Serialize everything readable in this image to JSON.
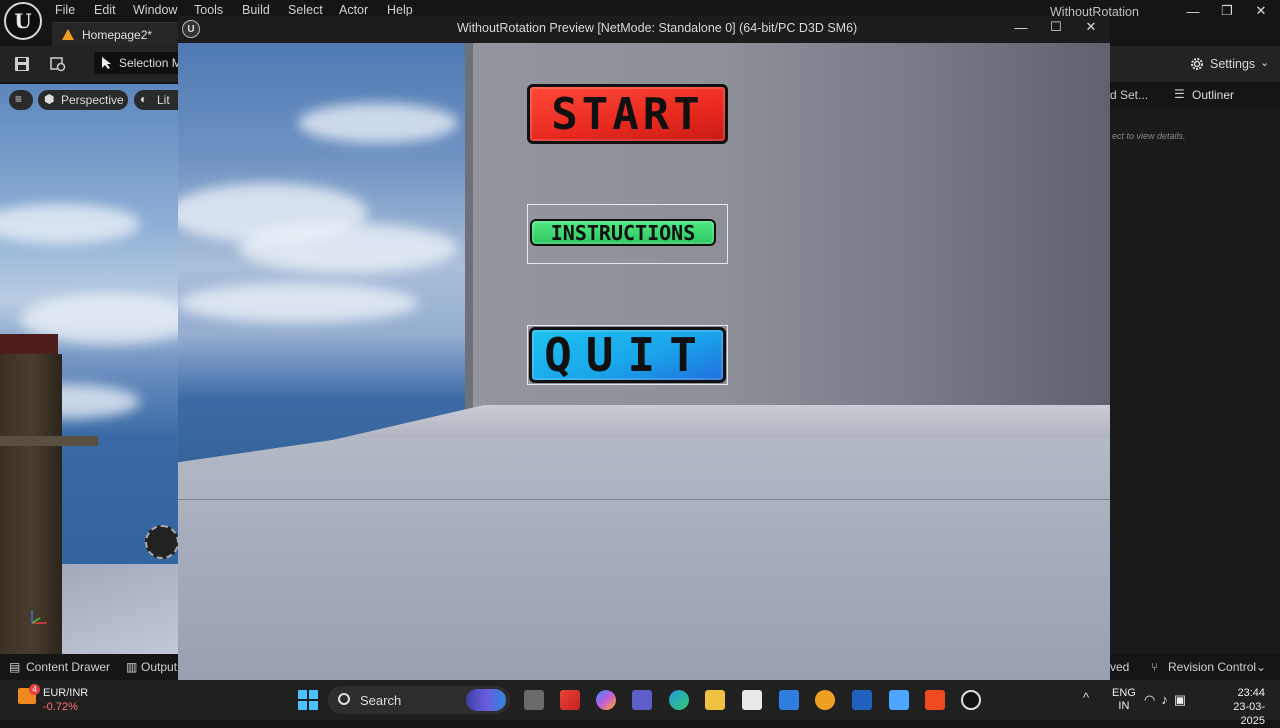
{
  "editor": {
    "menu": [
      "File",
      "Edit",
      "Window",
      "Tools",
      "Build",
      "Select",
      "Actor",
      "Help"
    ],
    "window_title": "WithoutRotation",
    "level_tab": "Homepage2*",
    "selection_mode": "Selection M",
    "settings": "Settings",
    "viewport": {
      "perspective": "Perspective",
      "lit": "Lit"
    },
    "right_tabs": {
      "details": "d Set...",
      "outliner": "Outliner"
    },
    "details_hint": "ect to view details.",
    "bottom": {
      "content_drawer": "Content Drawer",
      "output": "Output",
      "saved": "ved",
      "revision_control": "Revision Control"
    }
  },
  "preview": {
    "title": "WithoutRotation Preview [NetMode: Standalone 0]  (64-bit/PC D3D SM6)",
    "buttons": {
      "start": "START",
      "instructions": "INSTRUCTIONS",
      "quit": "QUIT"
    }
  },
  "taskbar": {
    "ticker": {
      "pair": "EUR/INR",
      "change": "-0.72%",
      "badge": "4"
    },
    "search": "Search",
    "lang": {
      "line1": "ENG",
      "line2": "IN"
    },
    "time": "23:44",
    "date": "23-03-2025"
  }
}
